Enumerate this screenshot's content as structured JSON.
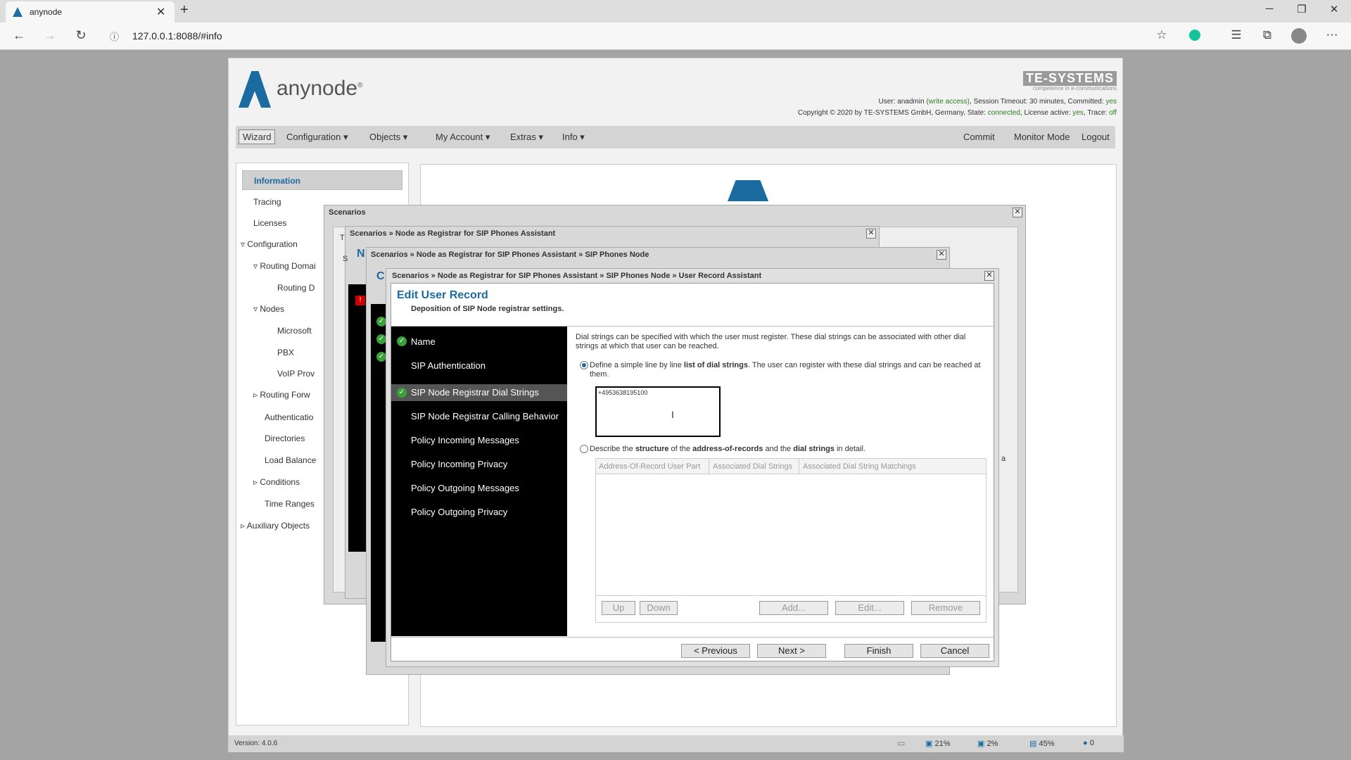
{
  "browser": {
    "tab_title": "anynode",
    "url": "127.0.0.1:8088/#info"
  },
  "header": {
    "logo_text": "anynode",
    "logo_reg": "®",
    "brand": "TE-SYSTEMS",
    "brand_sub": "competence in e-communications",
    "user_line": {
      "p1": "User: anadmin ",
      "p2": "(write access)",
      "p3": ", Session Timeout: 30 minutes, Committed: ",
      "p4": "yes"
    },
    "copy_line": {
      "p1": "Copyright © 2020 by TE-SYSTEMS GmbH, Germany, State: ",
      "p2": "connected",
      "p3": ", License active: ",
      "p4": "yes",
      "p5": ", Trace: ",
      "p6": "off"
    }
  },
  "menu": {
    "wizard": "Wizard",
    "configuration": "Configuration",
    "objects": "Objects",
    "my_account": "My Account",
    "extras": "Extras",
    "info": "Info",
    "commit": "Commit",
    "monitor": "Monitor Mode",
    "logout": "Logout"
  },
  "sidebar": {
    "information": "Information",
    "tracing": "Tracing",
    "licenses": "Licenses",
    "configuration": "Configuration",
    "routing_domains": "Routing Domai",
    "routing_d": "Routing D",
    "nodes": "Nodes",
    "microsoft": "Microsoft",
    "pbx": "PBX",
    "voip": "VoIP Prov",
    "routing_forw": "Routing Forw",
    "authentication": "Authenticatio",
    "directories": "Directories",
    "load_balance": "Load Balance",
    "conditions": "Conditions",
    "time_ranges": "Time Ranges",
    "aux": "Auxiliary Objects"
  },
  "status": {
    "version": "Version: 4.0.6",
    "cpu": "21%",
    "disk": "2%",
    "mem": "45%",
    "alerts": "0"
  },
  "dialogs": {
    "d1": "Scenarios",
    "d2": "Scenarios » Node as Registrar for SIP Phones Assistant",
    "d3": "Scenarios » Node as Registrar for SIP Phones Assistant » SIP Phones Node",
    "d4": "Scenarios » Node as Registrar for SIP Phones Assistant » SIP Phones Node » User Record Assistant",
    "behind_t": "T",
    "behind_s": "S",
    "behind_n": "N",
    "behind_c": "C",
    "behind_a": "a"
  },
  "wizard": {
    "title": "Edit User Record",
    "subtitle": "Deposition of SIP Node registrar settings.",
    "steps": [
      "Name",
      "SIP Authentication",
      "SIP Node Registrar Dial Strings",
      "SIP Node Registrar Calling Behavior",
      "Policy Incoming Messages",
      "Policy Incoming Privacy",
      "Policy Outgoing Messages",
      "Policy Outgoing Privacy"
    ],
    "intro": "Dial strings can be specified with which the user must register. These dial strings can be associated with other dial strings at which that user can be reached.",
    "opt1": {
      "a": "Define a simple line by line ",
      "b": "list of dial strings",
      "c": ". The user can register with these dial strings and can be reached at them."
    },
    "dial_value": "+4953638195100",
    "opt2": {
      "a": "Describe the ",
      "b": "structure",
      "c": " of the ",
      "d": "address-of-records",
      "e": " and the ",
      "f": "dial strings",
      "g": " in detail."
    },
    "columns": [
      "Address-Of-Record User Part",
      "Associated Dial Strings",
      "Associated Dial String Matchings"
    ],
    "btn_up": "Up",
    "btn_down": "Down",
    "btn_add": "Add...",
    "btn_edit": "Edit...",
    "btn_remove": "Remove",
    "btn_prev": "< Previous",
    "btn_next": "Next >",
    "btn_finish": "Finish",
    "btn_cancel": "Cancel"
  }
}
